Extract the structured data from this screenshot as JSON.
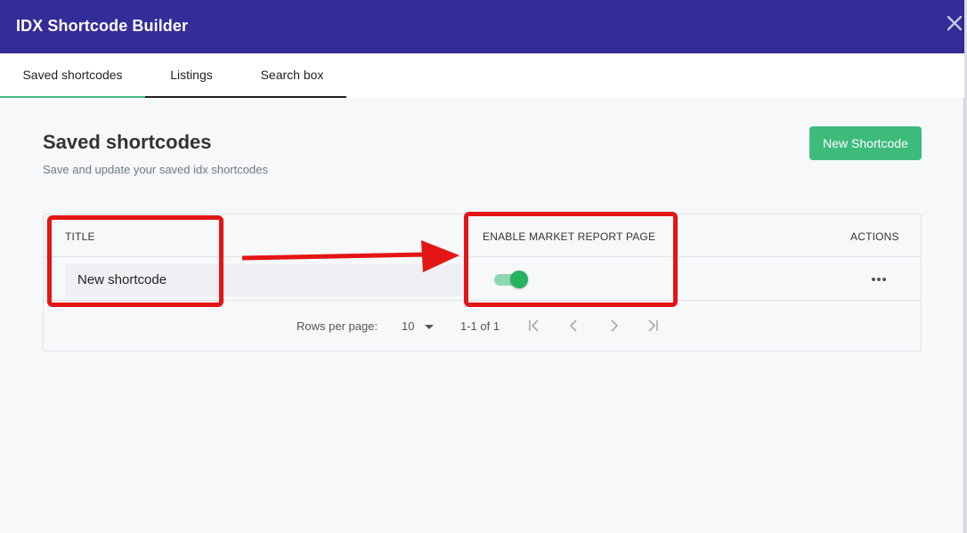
{
  "header": {
    "title": "IDX Shortcode Builder",
    "close_icon": "close-icon",
    "bg_color": "#332c99"
  },
  "tabs": [
    {
      "label": "Saved shortcodes",
      "active": true
    },
    {
      "label": "Listings",
      "active": false
    },
    {
      "label": "Search box",
      "active": false
    }
  ],
  "page": {
    "title": "Saved shortcodes",
    "subtitle": "Save and update your saved idx shortcodes",
    "new_button_label": "New Shortcode",
    "accent_color": "#3cbb7b"
  },
  "table": {
    "columns": [
      "TITLE",
      "ENABLE MARKET REPORT PAGE",
      "ACTIONS"
    ],
    "rows": [
      {
        "title": "New shortcode",
        "market_report_enabled": true,
        "actions_icon": "more-horizontal-icon"
      }
    ],
    "footer": {
      "rows_per_page_label": "Rows per page:",
      "rows_per_page_value": "10",
      "range_text": "1-1 of 1"
    }
  },
  "annotation_color": "#e41515"
}
